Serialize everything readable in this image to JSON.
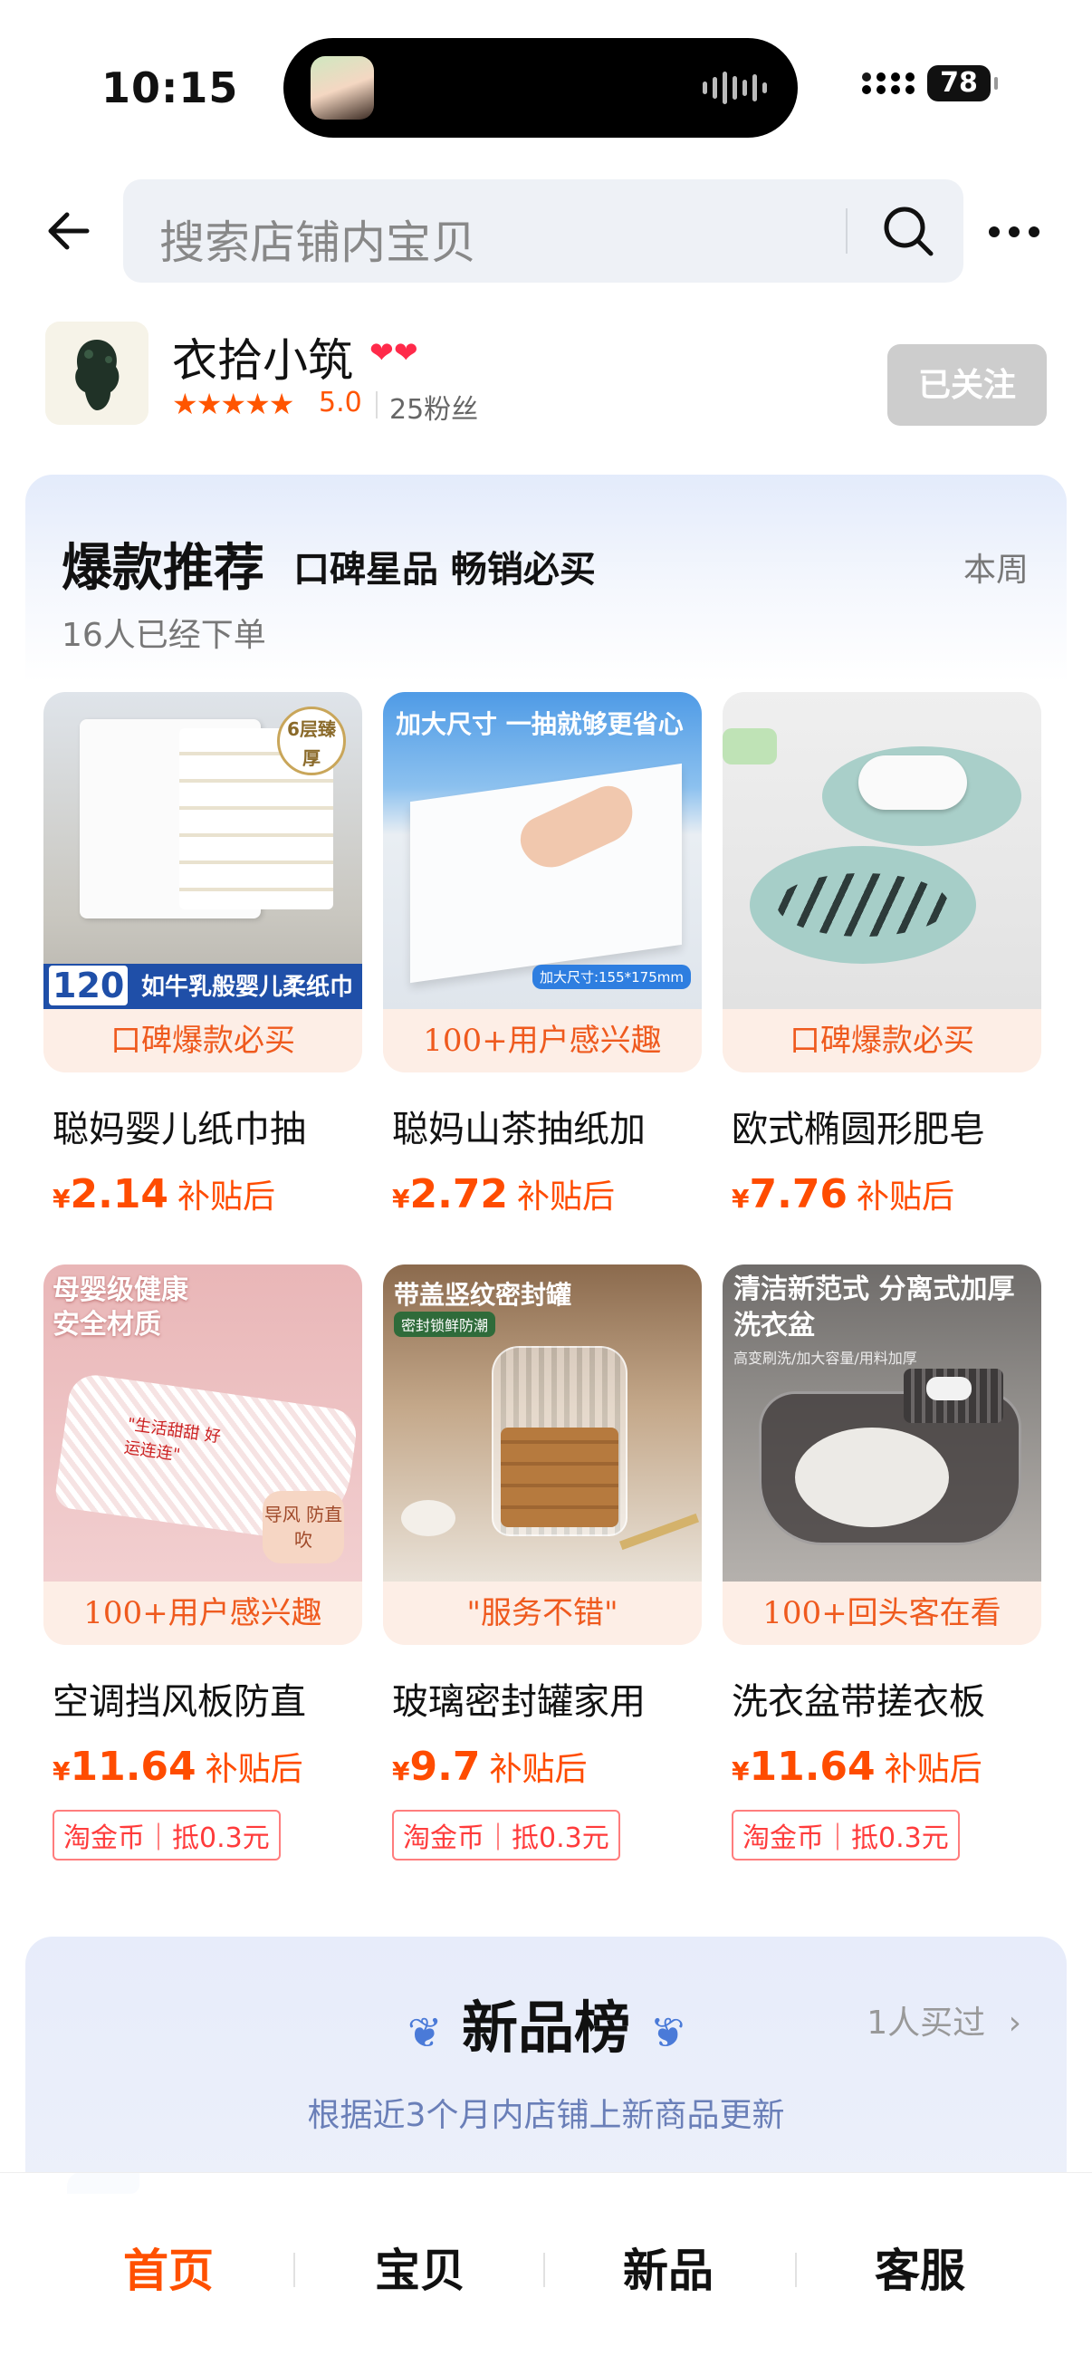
{
  "status_bar": {
    "time": "10:15",
    "battery": "78"
  },
  "search": {
    "placeholder": "搜索店铺内宝贝"
  },
  "store": {
    "name": "衣拾小筑",
    "hearts": "❤❤",
    "stars": "★★★★★",
    "rating": "5.0",
    "fans": "25粉丝",
    "follow_label": "已关注"
  },
  "hot": {
    "title": "爆款推荐",
    "subtitle": "口碑星品 畅销必买",
    "period": "本周",
    "order_count": "16人已经下单",
    "products": [
      {
        "tag": "口碑爆款必买",
        "name": "聪妈婴儿纸巾抽",
        "currency": "¥",
        "price": "2.14",
        "price_label": "补贴后",
        "coin": "",
        "image_text": "如牛乳般婴儿柔纸巾",
        "image_badge": "6层臻厚",
        "image_count": "120"
      },
      {
        "tag": "100+用户感兴趣",
        "name": "聪妈山茶抽纸加",
        "currency": "¥",
        "price": "2.72",
        "price_label": "补贴后",
        "coin": "",
        "image_text": "加大尺寸 一抽就够更省心",
        "image_badge": "加大尺寸:155*175mm"
      },
      {
        "tag": "口碑爆款必买",
        "name": "欧式椭圆形肥皂",
        "currency": "¥",
        "price": "7.76",
        "price_label": "补贴后",
        "coin": ""
      },
      {
        "tag": "100+用户感兴趣",
        "name": "空调挡风板防直",
        "currency": "¥",
        "price": "11.64",
        "price_label": "补贴后",
        "coin": "淘金币｜抵0.3元",
        "image_text": "母婴级健康 安全材质",
        "image_badge": "导风 防直吹"
      },
      {
        "tag": "\"服务不错\"",
        "name": "玻璃密封罐家用",
        "currency": "¥",
        "price": "9.7",
        "price_label": "补贴后",
        "coin": "淘金币｜抵0.3元",
        "image_text": "带盖竖纹密封罐",
        "image_badge": "密封锁鲜防潮"
      },
      {
        "tag": "100+回头客在看",
        "name": "洗衣盆带搓衣板",
        "currency": "¥",
        "price": "11.64",
        "price_label": "补贴后",
        "coin": "淘金币｜抵0.3元",
        "image_text": "清洁新范式 分离式加厚洗衣盆",
        "image_badge": "高变刷洗/加大容量/用料加厚"
      }
    ]
  },
  "new_products": {
    "title": "新品榜",
    "bought": "1人买过",
    "subtitle": "根据近3个月内店铺上新商品更新"
  },
  "tabs": [
    {
      "label": "首页",
      "active": true
    },
    {
      "label": "宝贝",
      "active": false
    },
    {
      "label": "新品",
      "active": false
    },
    {
      "label": "客服",
      "active": false
    }
  ],
  "colors": {
    "accent": "#ff5000",
    "price": "#ff4c00",
    "tag_bg": "#fdeee6",
    "tag_text": "#ef5a1e"
  }
}
